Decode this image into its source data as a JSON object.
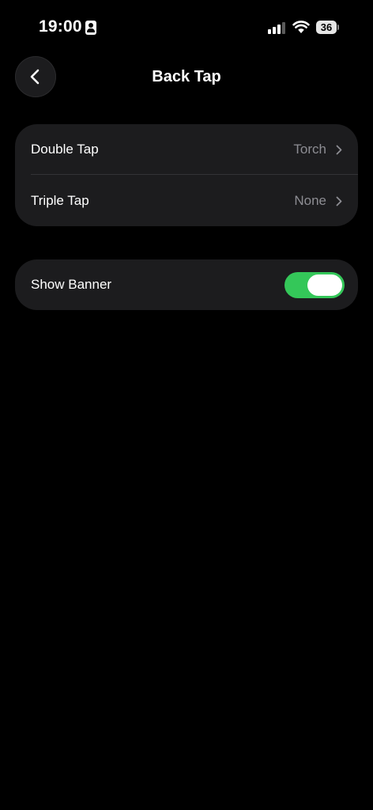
{
  "status_bar": {
    "time": "19:00",
    "battery_level": "36",
    "icons": [
      "contact-card-icon",
      "signal-icon",
      "wifi-icon",
      "battery-icon"
    ],
    "signal_bars_active": 3,
    "signal_bars_total": 4
  },
  "header": {
    "title": "Back Tap",
    "back_icon": "chevron-left-icon"
  },
  "tap_settings": [
    {
      "label": "Double Tap",
      "value": "Torch"
    },
    {
      "label": "Triple Tap",
      "value": "None"
    }
  ],
  "banner_setting": {
    "label": "Show Banner",
    "enabled": true
  },
  "colors": {
    "background": "#000000",
    "group_background": "#1c1c1e",
    "secondary_text": "#8d8d93",
    "toggle_on": "#34c759"
  }
}
